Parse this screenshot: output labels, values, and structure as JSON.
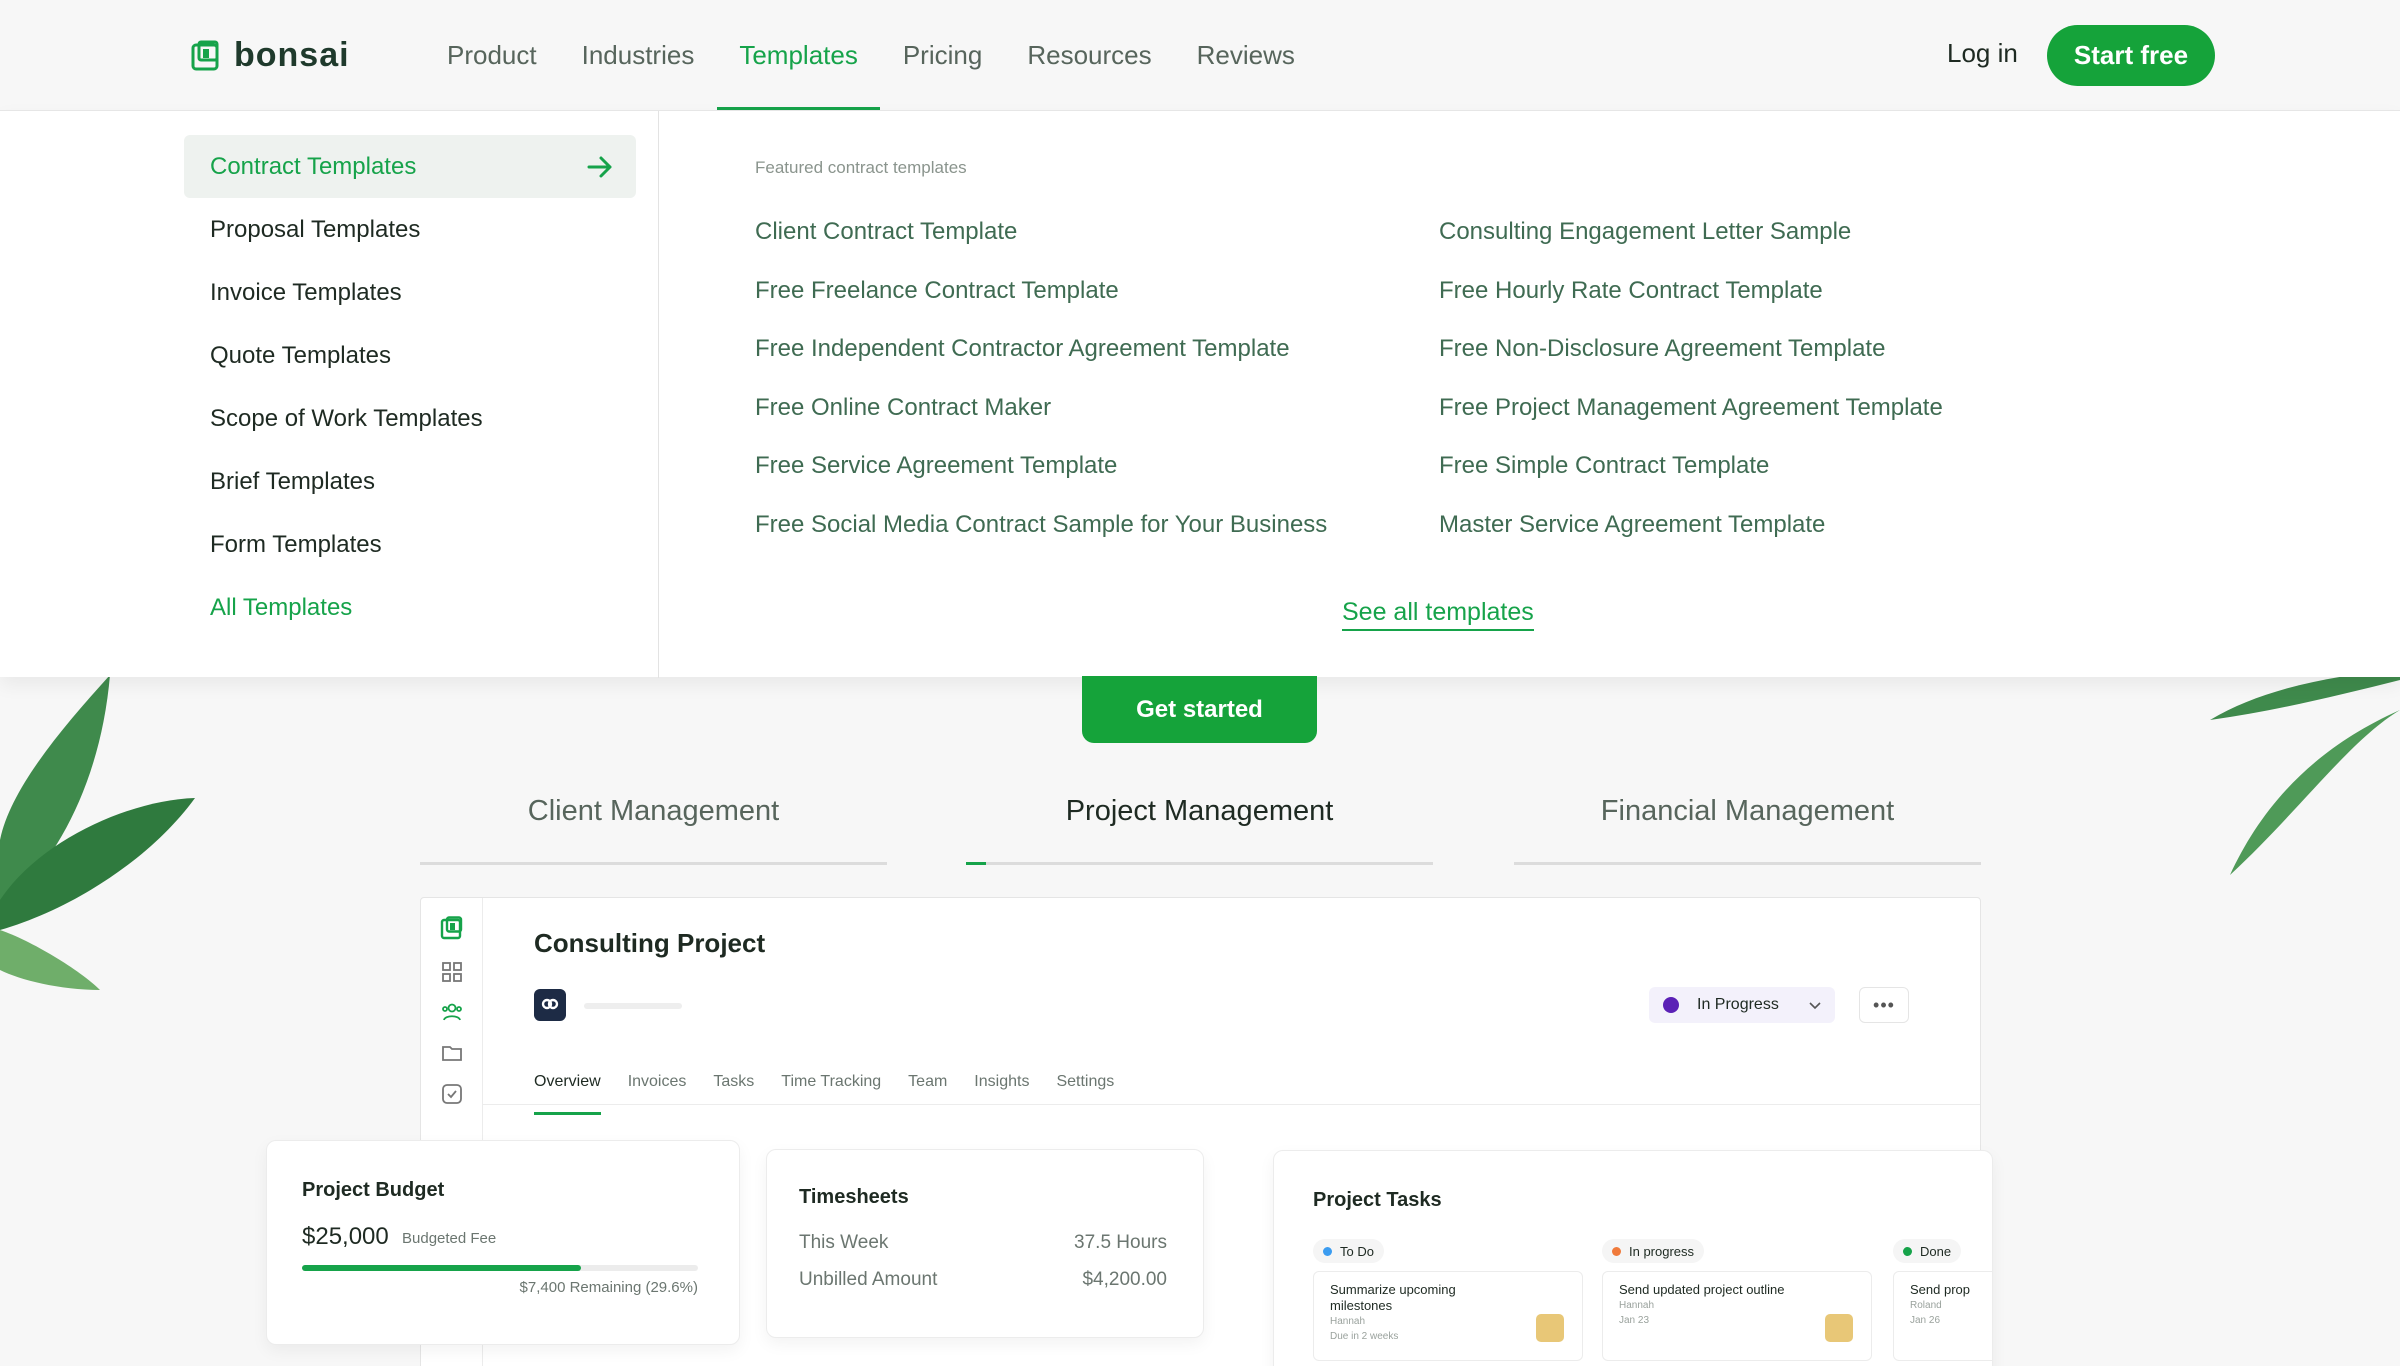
{
  "brand": {
    "name": "bonsai",
    "accent": "#16a34a"
  },
  "nav": {
    "items": [
      "Product",
      "Industries",
      "Templates",
      "Pricing",
      "Resources",
      "Reviews"
    ],
    "active": "Templates",
    "login": "Log in",
    "cta": "Start free"
  },
  "menu": {
    "categories": [
      "Contract Templates",
      "Proposal Templates",
      "Invoice Templates",
      "Quote Templates",
      "Scope of Work Templates",
      "Brief Templates",
      "Form Templates"
    ],
    "all": "All Templates",
    "featured_label": "Featured contract templates",
    "featured_col1": [
      "Client Contract Template",
      "Free Freelance Contract Template",
      "Free Independent Contractor Agreement Template",
      "Free Online Contract Maker",
      "Free Service Agreement Template",
      "Free Social Media Contract Sample for Your Business"
    ],
    "featured_col2": [
      "Consulting Engagement Letter Sample",
      "Free Hourly Rate Contract Template",
      "Free Non-Disclosure Agreement Template",
      "Free Project Management Agreement Template",
      "Free Simple Contract Template",
      "Master Service Agreement Template"
    ],
    "see_all": "See all templates"
  },
  "hero": {
    "cta": "Get started",
    "feature_tabs": [
      "Client Management",
      "Project Management",
      "Financial Management"
    ],
    "active_tab": "Project Management"
  },
  "app": {
    "title": "Consulting Project",
    "status": "In Progress",
    "more": "•••",
    "tabs": [
      "Overview",
      "Invoices",
      "Tasks",
      "Time Tracking",
      "Team",
      "Insights",
      "Settings"
    ],
    "budget": {
      "title": "Project Budget",
      "amount": "$25,000",
      "label": "Budgeted Fee",
      "used_fraction": 0.704,
      "remaining": "$7,400 Remaining (29.6%)"
    },
    "timesheets": {
      "title": "Timesheets",
      "rows": [
        {
          "label": "This Week",
          "value": "37.5 Hours"
        },
        {
          "label": "Unbilled Amount",
          "value": "$4,200.00"
        }
      ]
    },
    "tasks": {
      "title": "Project Tasks",
      "columns": [
        {
          "name": "To Do",
          "color": "#3b9cf0",
          "task": "Summarize upcoming milestones",
          "owner": "Hannah",
          "due": "Due in 2 weeks"
        },
        {
          "name": "In progress",
          "color": "#f07a3b",
          "task": "Send updated project outline",
          "owner": "Hannah",
          "due": "Jan 23"
        },
        {
          "name": "Done",
          "color": "#16a34a",
          "task": "Send prop",
          "owner": "Roland",
          "due": "Jan 26"
        }
      ]
    }
  }
}
